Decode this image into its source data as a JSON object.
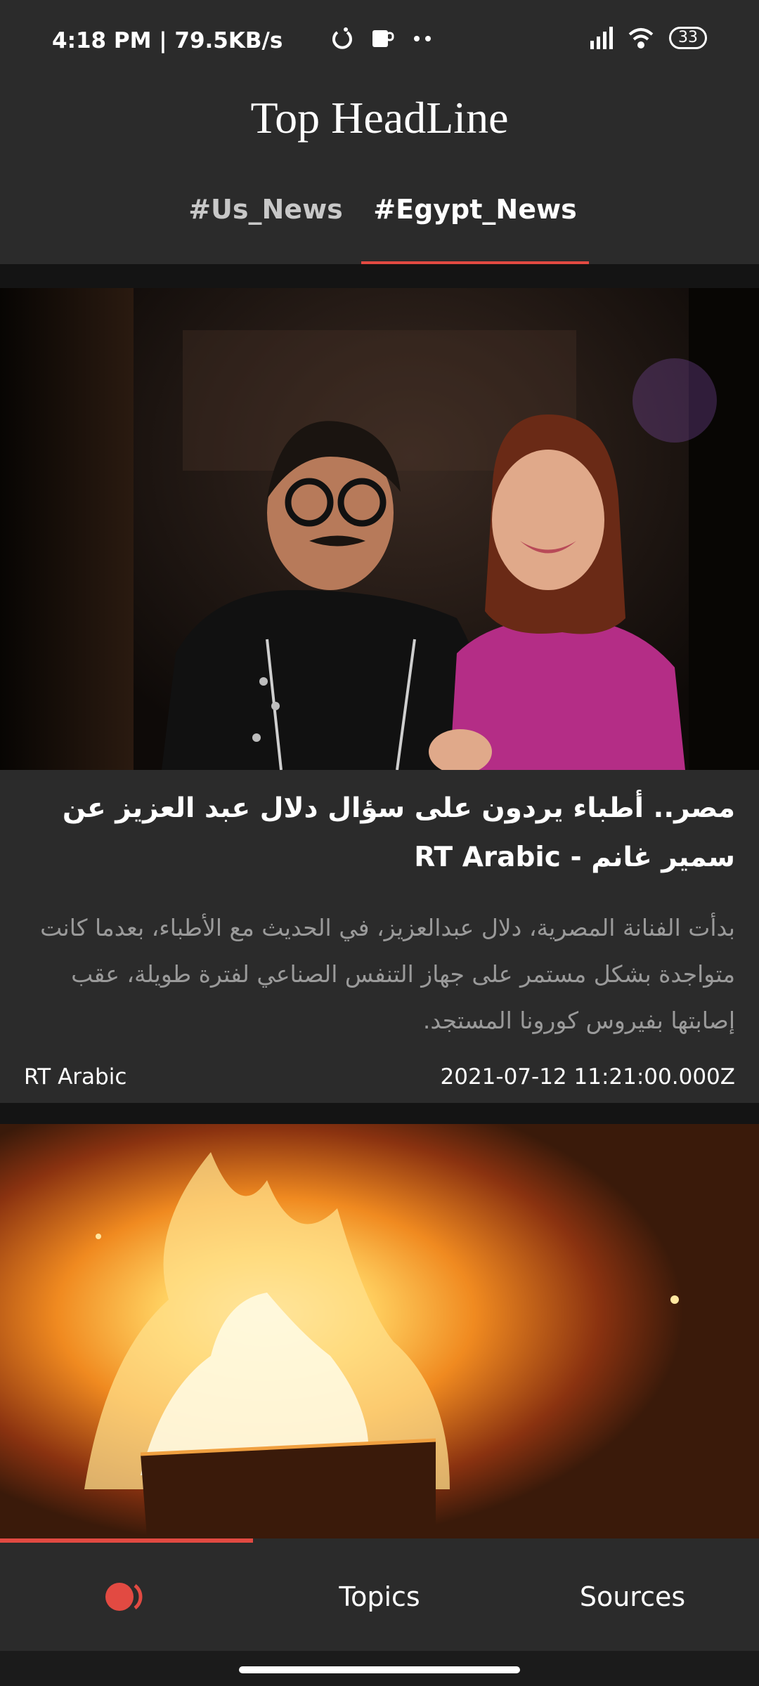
{
  "status_bar": {
    "time_and_speed": "4:18 PM | 79.5KB/s",
    "battery": "33",
    "icons": [
      "sync-icon",
      "coffee-cup-icon",
      "more-dots-icon",
      "signal-icon",
      "wifi-icon",
      "battery-icon"
    ]
  },
  "header": {
    "title": "Top HeadLine",
    "tabs": [
      {
        "label": "#Us_News",
        "selected": false
      },
      {
        "label": "#Egypt_News",
        "selected": true
      }
    ]
  },
  "articles": [
    {
      "title": "مصر.. أطباء يردون على سؤال دلال عبد العزيز عن سمير غانم - RT Arabic",
      "description": "بدأت الفنانة المصرية، دلال عبدالعزيز، في الحديث مع الأطباء، بعدما كانت متواجدة بشكل مستمر على جهاز التنفس الصناعي لفترة طويلة، عقب إصابتها بفيروس كورونا المستجد.",
      "source": "RT Arabic",
      "date": "2021-07-12 11:21:00.000Z",
      "image": "photo-couple-at-event"
    },
    {
      "image": "photo-burning-fire-at-night"
    }
  ],
  "progress": 0.333,
  "bottom_nav": {
    "home_icon": "record-icon",
    "topics": "Topics",
    "sources": "Sources"
  },
  "colors": {
    "accent": "#e24a42",
    "background": "#1b1b1b",
    "surface": "#2b2b2b",
    "text_primary": "#ffffff",
    "text_secondary": "#9a9a9a"
  }
}
